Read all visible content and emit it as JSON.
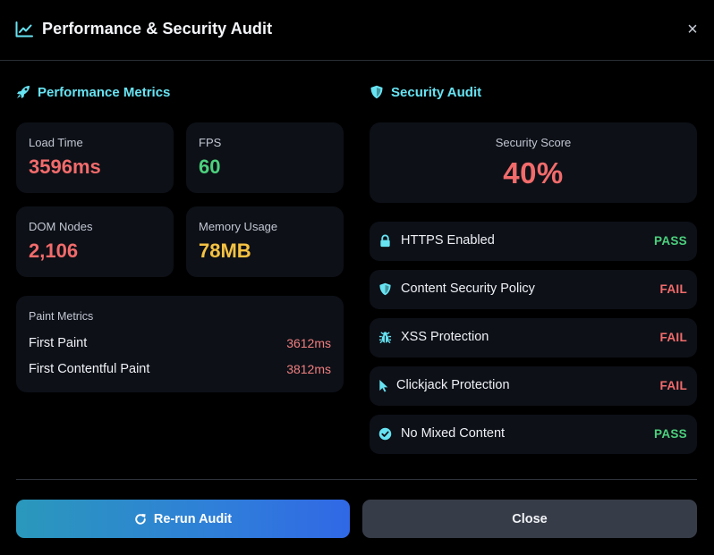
{
  "header": {
    "title": "Performance & Security Audit",
    "icon": "chart-line-icon",
    "close_label": "×"
  },
  "performance": {
    "heading": "Performance Metrics",
    "icon": "rocket-icon",
    "metrics": [
      {
        "label": "Load Time",
        "value": "3596ms",
        "color": "#f26b6b"
      },
      {
        "label": "FPS",
        "value": "60",
        "color": "#4cd07d"
      },
      {
        "label": "DOM Nodes",
        "value": "2,106",
        "color": "#f26b6b"
      },
      {
        "label": "Memory Usage",
        "value": "78MB",
        "color": "#f5c242"
      }
    ],
    "paint": {
      "title": "Paint Metrics",
      "rows": [
        {
          "name": "First Paint",
          "value": "3612ms"
        },
        {
          "name": "First Contentful Paint",
          "value": "3812ms"
        }
      ]
    }
  },
  "security": {
    "heading": "Security Audit",
    "icon": "shield-icon",
    "score_label": "Security Score",
    "score_value": "40%",
    "checks": [
      {
        "name": "HTTPS Enabled",
        "status": "PASS",
        "icon": "lock-icon"
      },
      {
        "name": "Content Security Policy",
        "status": "FAIL",
        "icon": "shield-icon"
      },
      {
        "name": "XSS Protection",
        "status": "FAIL",
        "icon": "bug-icon"
      },
      {
        "name": "Clickjack Protection",
        "status": "FAIL",
        "icon": "cursor-icon"
      },
      {
        "name": "No Mixed Content",
        "status": "PASS",
        "icon": "check-circle-icon"
      }
    ]
  },
  "colors": {
    "accent": "#67e3f2",
    "pass": "#4cd07d",
    "fail": "#f26b6b"
  },
  "actions": {
    "rerun_label": "Re-run Audit",
    "close_label": "Close"
  }
}
